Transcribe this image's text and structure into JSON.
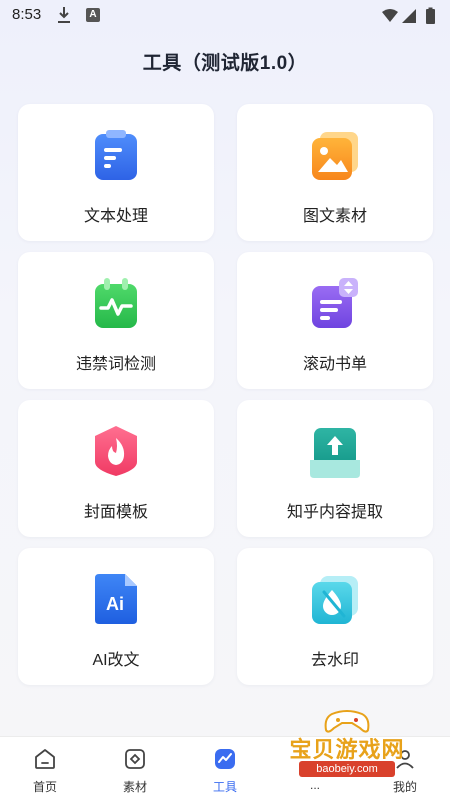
{
  "status": {
    "time": "8:53",
    "icons": [
      "download-icon",
      "a-badge-icon",
      "wifi-icon",
      "signal-icon",
      "battery-icon"
    ],
    "a_badge": "A"
  },
  "header": {
    "title": "工具（测试版1.0）"
  },
  "tools": [
    {
      "label": "文本处理",
      "icon": "document-icon"
    },
    {
      "label": "图文素材",
      "icon": "image-icon"
    },
    {
      "label": "违禁词检测",
      "icon": "pulse-clipboard-icon"
    },
    {
      "label": "滚动书单",
      "icon": "scroll-list-icon"
    },
    {
      "label": "封面模板",
      "icon": "flame-icon"
    },
    {
      "label": "知乎内容提取",
      "icon": "upload-tray-icon"
    },
    {
      "label": "AI改文",
      "icon": "ai-document-icon",
      "icon_text": "Ai"
    },
    {
      "label": "去水印",
      "icon": "water-drop-icon"
    }
  ],
  "tabbar": {
    "items": [
      {
        "label": "首页",
        "icon": "home-icon",
        "active": false
      },
      {
        "label": "素材",
        "icon": "material-icon",
        "active": false
      },
      {
        "label": "工具",
        "icon": "chart-icon",
        "active": true
      },
      {
        "label": "...",
        "icon": "unknown-icon",
        "active": false
      },
      {
        "label": "我的",
        "icon": "profile-icon",
        "active": false
      }
    ]
  },
  "watermark": {
    "text": "宝贝游戏网",
    "url": "baobeiy.com"
  },
  "colors": {
    "accent": "#3a6cf0",
    "brand_orange": "#e8a21a",
    "badge_red": "#d9412c"
  }
}
